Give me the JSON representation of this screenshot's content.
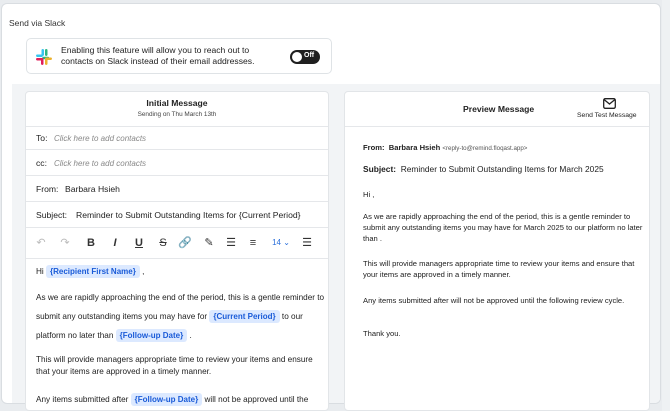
{
  "section_title": "Send via Slack",
  "slack": {
    "description": "Enabling this feature will allow you to reach out to contacts on Slack instead of their email addresses.",
    "toggle_label": "Off"
  },
  "composer": {
    "title": "Initial Message",
    "subtitle": "Sending on Thu March 13th",
    "to_label": "To:",
    "to_placeholder": "Click here to add contacts",
    "cc_label": "cc:",
    "cc_placeholder": "Click here to add contacts",
    "from_label": "From:",
    "from_value": "Barbara Hsieh",
    "subject_label": "Subject:",
    "subject_value": "Reminder to Submit Outstanding Items for {Current Period}",
    "font_size": "14",
    "body": {
      "greeting_prefix": "Hi",
      "recipient_chip": "{Recipient First Name}",
      "greeting_suffix": ",",
      "p1_a": "As we are rapidly approaching the end of the period, this is a gentle reminder to submit any outstanding items you may have for",
      "p1_chip1": "{Current Period}",
      "p1_b": "to our platform no later than",
      "p1_chip2": "{Follow-up Date}",
      "p1_c": ".",
      "p2": "This will provide managers appropriate time to review your items and ensure that your items are approved in a timely manner.",
      "p3_a": "Any items submitted after",
      "p3_chip": "{Follow-up Date}",
      "p3_b": "will not be approved until the"
    }
  },
  "preview": {
    "title": "Preview Message",
    "send_test": "Send Test Message",
    "from_label": "From:",
    "from_name": "Barbara Hsieh",
    "from_email": "<reply-to@remind.floqast.app>",
    "subject_label": "Subject:",
    "subject_value": "Reminder to Submit Outstanding Items for March 2025",
    "greeting": "Hi ,",
    "p1": "As we are rapidly approaching the end of the period, this is a gentle reminder to submit any outstanding items you may have for March 2025 to our platform no later than .",
    "p2": "This will provide managers appropriate time to review your items and ensure that your items are approved in a timely manner.",
    "p3": "Any items submitted after will not be approved until the following review cycle.",
    "p4": "Thank you."
  }
}
